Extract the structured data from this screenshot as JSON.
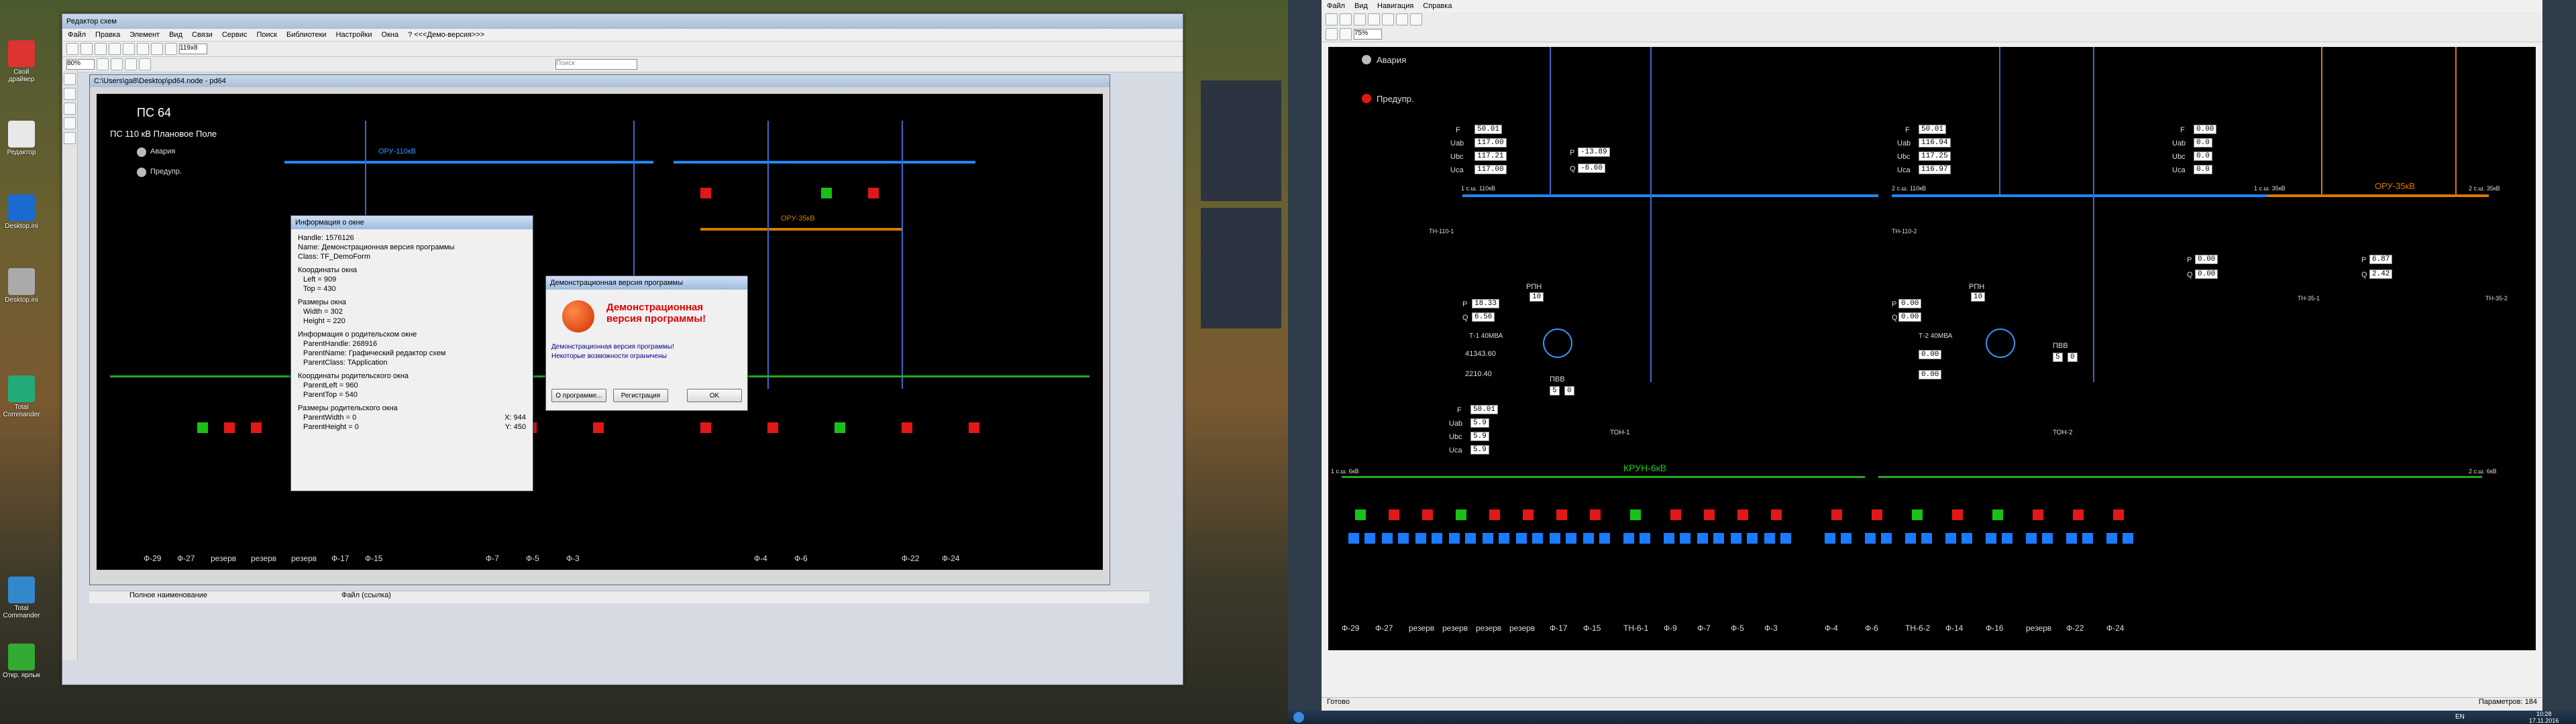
{
  "left_app": {
    "title": "Редактор схем",
    "menu": [
      "Файл",
      "Правка",
      "Элемент",
      "Вид",
      "Связи",
      "Сервис",
      "Поиск",
      "Библиотеки",
      "Настройки",
      "Окна",
      "? <<<Демо-версия>>>"
    ],
    "zoom": "80%",
    "size_field": "119x8",
    "search_placeholder": "Поиск",
    "doc_title": "C:\\Users\\ga8\\Desktop\\pd64.node - pd64",
    "status_left": "Полное наименование",
    "status_right": "Файл (ссылка)",
    "scheme": {
      "title": "ПС 64",
      "subtitle": "ПС 110 кВ Плановое Поле",
      "legend_alarm": "Авария",
      "legend_warn": "Предупр.",
      "bus_label": "ОРУ-110кВ",
      "bus_label2": "ОРУ-35кВ",
      "feeders": [
        "Ф-29",
        "Ф-27",
        "резерв",
        "резерв",
        "резерв",
        "Ф-17",
        "Ф-15",
        "Ф-7",
        "Ф-5",
        "Ф-3",
        "Ф-4",
        "Ф-6",
        "Ф-22",
        "Ф-24"
      ]
    },
    "info_dialog": {
      "title": "Информация о окне",
      "handle": "Handle: 1576126",
      "name": "Name: Демонстрационная версия программы",
      "class": "Class: TF_DemoForm",
      "coords_head": "Координаты окна",
      "left": "Left = 909",
      "top": "Top = 430",
      "size_head": "Размеры окна",
      "width": "Width = 302",
      "height": "Height = 220",
      "parent_head": "Информация о родительском окне",
      "parent_handle": "ParentHandle: 268916",
      "parent_name": "ParentName: Графический редактор схем",
      "parent_class": "ParentClass: TApplication",
      "parent_coords_head": "Координаты родительского окна",
      "parent_left": "ParentLeft = 960",
      "parent_top": "ParentTop = 540",
      "parent_size_head": "Размеры родительского окна",
      "parent_width": "ParentWidth = 0",
      "parent_height": "ParentHeight = 0",
      "x": "X: 944",
      "y": "Y: 450"
    },
    "demo_dialog": {
      "title": "Демонстрационная версия программы",
      "heading": "Демонстрационная версия программы!",
      "line1": "Демонстрационная версия программы!",
      "line2": "Некоторые возможности ограничены",
      "btn_about": "О программе...",
      "btn_register": "Регистрация",
      "btn_ok": "OK"
    }
  },
  "right_app": {
    "menu": [
      "Файл",
      "Вид",
      "Навигация",
      "Справка"
    ],
    "zoom": "75%",
    "legend_alarm": "Авария",
    "legend_warn": "Предупр.",
    "bus_35_label": "ОРУ-35кВ",
    "bus_6_label": "КРУН-6кВ",
    "t1": {
      "label": "Т-1 40МВА",
      "f": "50.01",
      "uab": "117.00",
      "ubc": "117.21",
      "uca": "117.00",
      "p": "-13.89",
      "q": "-6.60",
      "p2": "18.33",
      "q2": "6.56",
      "p3": "41343.60",
      "q3": "2210.40",
      "rpn": "10"
    },
    "t2": {
      "label": "Т-2 40МВА",
      "f": "50.01",
      "uab": "116.94",
      "ubc": "117.25",
      "uca": "116.97",
      "p2": "0.00",
      "q2": "0.00",
      "p3": "0.00",
      "q3": "0.00",
      "rpn": "10"
    },
    "bus35": {
      "f": "0.00",
      "uab": "0.0",
      "ubc": "0.0",
      "uca": "0.0",
      "p": "0.00",
      "q": "0.00",
      "p2": "6.87",
      "q2": "2.42"
    },
    "bus6": {
      "f": "50.01",
      "uab": "5.9",
      "ubc": "5.9",
      "uca": "5.9",
      "pvv": "5",
      "pvv2": "0",
      "pvv3": "5",
      "pvv4": "0"
    },
    "labels": {
      "rpn": "РПН",
      "pvv": "ПВВ",
      "f": "F",
      "uab": "Uab",
      "ubc": "Ubc",
      "uca": "Uca",
      "p": "P",
      "q": "Q",
      "tn1": "ТН-110-1",
      "tn2": "ТН-110-2",
      "ton1": "ТОН-1",
      "ton2": "ТОН-2",
      "tn61": "ТН-6-1",
      "tn62": "ТН-6-2",
      "tn351": "ТН-35-1",
      "tn352": "ТН-35-2",
      "sec1": "1 с.ш. 6кВ",
      "sec2": "2 с.ш. 6кВ",
      "sec110_1": "1 с.ш. 110кВ",
      "sec110_2": "2 с.ш. 110кВ",
      "sec35_1": "1 с.ш. 35кВ",
      "sec35_2": "2 с.ш. 35кВ"
    },
    "feeders": [
      "Ф-29",
      "Ф-27",
      "резерв",
      "резерв",
      "резерв",
      "резерв",
      "Ф-17",
      "Ф-15",
      "ТН-6-1",
      "Ф-9",
      "Ф-7",
      "Ф-5",
      "Ф-3",
      "Ф-4",
      "Ф-6",
      "ТН-6-2",
      "Ф-14",
      "Ф-16",
      "резерв",
      "Ф-22",
      "Ф-24"
    ],
    "status_left": "Готово",
    "status_right": "Параметров: 184"
  },
  "taskbar": {
    "lang": "EN",
    "time": "10:28",
    "date": "17.11.2016"
  },
  "desktop_icons": [
    "Свой драйвер",
    "Редактор",
    "Desktop.ini",
    "Desktop.ini",
    "Total Commander",
    "Total Commander",
    "Откр. ярлык"
  ],
  "colors": {
    "bus110": "#1e88ff",
    "bus35": "#d67a00",
    "bus6": "#22aa22",
    "alarm": "#e01818",
    "warn": "#18c018",
    "switch": "#1c7aff"
  }
}
